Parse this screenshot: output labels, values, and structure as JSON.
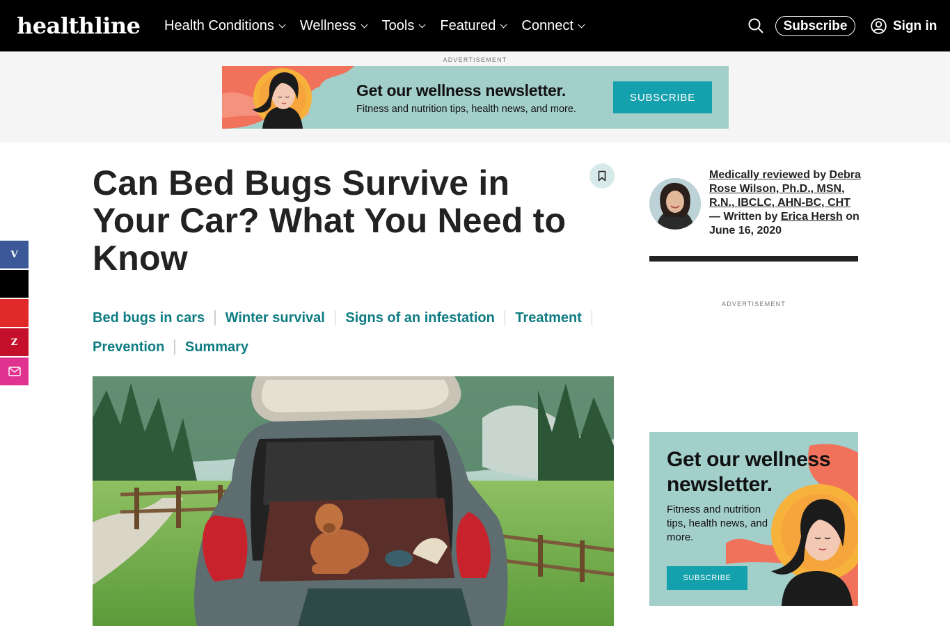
{
  "header": {
    "logo": "healthline",
    "nav": [
      "Health Conditions",
      "Wellness",
      "Tools",
      "Featured",
      "Connect"
    ],
    "subscribe_label": "Subscribe",
    "signin_label": "Sign in"
  },
  "top_ad": {
    "label": "ADVERTISEMENT",
    "title": "Get our wellness newsletter.",
    "subtitle": "Fitness and nutrition tips, health news, and more.",
    "button": "SUBSCRIBE"
  },
  "social": {
    "items": [
      {
        "glyph": "V",
        "color": "#3b5998"
      },
      {
        "glyph": "",
        "color": "#000000"
      },
      {
        "glyph": "",
        "color": "#e02a2a"
      },
      {
        "glyph": "Z",
        "color": "#c4102b"
      },
      {
        "glyph": "",
        "color": "#e0338f"
      }
    ]
  },
  "article": {
    "title": "Can Bed Bugs Survive in Your Car? What You Need to Know",
    "toc_row1": [
      "Bed bugs in cars",
      "Winter survival",
      "Signs of an infestation",
      "Treatment"
    ],
    "toc_row2": [
      "Prevention",
      "Summary"
    ]
  },
  "byline": {
    "reviewed_link": "Medically reviewed",
    "by": " by ",
    "reviewer": "Debra Rose Wilson, Ph.D., MSN, R.N., IBCLC, AHN-BC, CHT",
    "written": " — Written by ",
    "author": "Erica Hersh",
    "date": " on June 16, 2020"
  },
  "side_ad": {
    "label": "ADVERTISEMENT",
    "title": "Get our wellness newsletter.",
    "subtitle": "Fitness and nutrition tips, health news, and more.",
    "button": "SUBSCRIBE"
  },
  "colors": {
    "accent": "#0f7c83",
    "ad_bg": "#a3cfcb",
    "ad_button": "#14a0ac",
    "header_bg": "#000000"
  }
}
